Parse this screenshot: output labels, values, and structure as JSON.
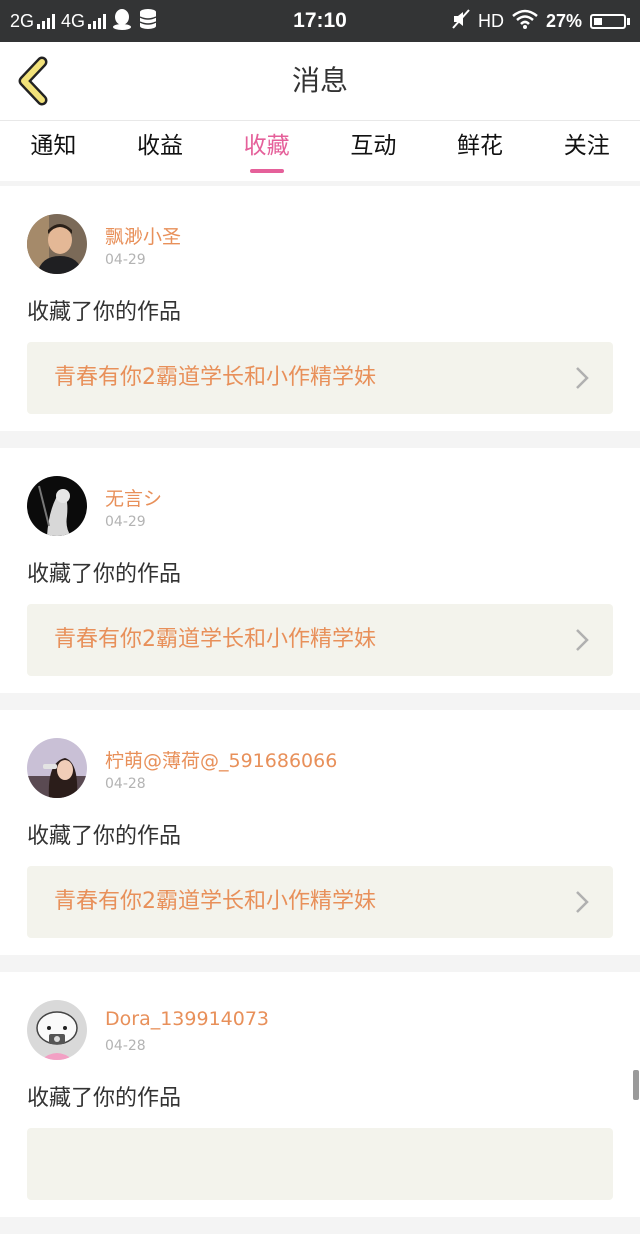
{
  "status_bar": {
    "net1": "2G",
    "net2": "4G",
    "time": "17:10",
    "hd": "HD",
    "battery": "27%",
    "battery_level": 0.27
  },
  "header": {
    "title": "消息"
  },
  "tabs": [
    {
      "label": "通知",
      "active": false
    },
    {
      "label": "收益",
      "active": false
    },
    {
      "label": "收藏",
      "active": true
    },
    {
      "label": "互动",
      "active": false
    },
    {
      "label": "鲜花",
      "active": false
    },
    {
      "label": "关注",
      "active": false
    }
  ],
  "messages": [
    {
      "username": "飘渺小圣",
      "date": "04-29",
      "action": "收藏了你的作品",
      "work_title": "青春有你2霸道学长和小作精学妹"
    },
    {
      "username": "无言シ",
      "date": "04-29",
      "action": "收藏了你的作品",
      "work_title": "青春有你2霸道学长和小作精学妹"
    },
    {
      "username": "柠萌@薄荷@_591686066",
      "date": "04-28",
      "action": "收藏了你的作品",
      "work_title": "青春有你2霸道学长和小作精学妹"
    },
    {
      "username": "Dora_139914073",
      "date": "04-28",
      "action": "收藏了你的作品",
      "work_title": ""
    }
  ],
  "colors": {
    "accent": "#e5609a",
    "username": "#e8905a",
    "work_bg": "#f3f3ec"
  }
}
